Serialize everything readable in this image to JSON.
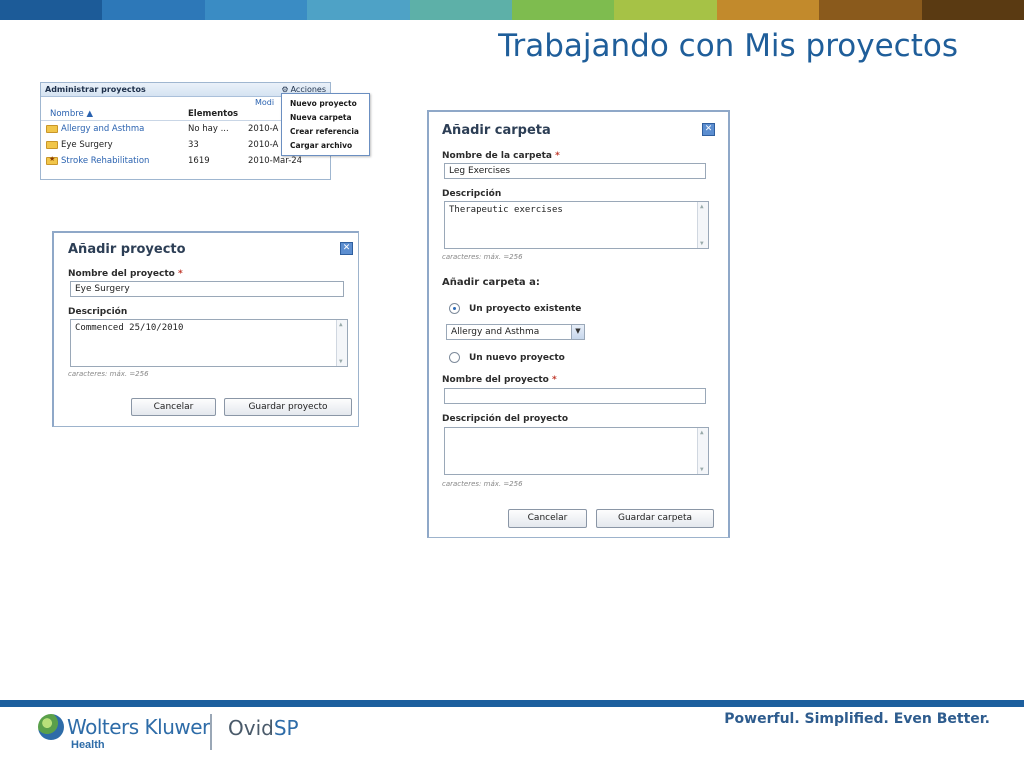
{
  "slide": {
    "title": "Trabajando con Mis proyectos",
    "banner_colors": [
      "#1c5b98",
      "#2d78b8",
      "#3a8cc4",
      "#4ea2c6",
      "#5db0a8",
      "#7ebc4f",
      "#a6c246",
      "#c28a2c",
      "#8a5a1c",
      "#5a3a12"
    ]
  },
  "manage_panel": {
    "header": "Administrar proyectos",
    "actions_label": "Acciones",
    "modify_label": "Modi",
    "columns": {
      "name": "Nombre ▲",
      "elements": "Elementos"
    },
    "rows": [
      {
        "name": "Allergy and Asthma",
        "elements": "No hay ...",
        "date": "2010-A",
        "icon": "folder-icon"
      },
      {
        "name": "Eye Surgery",
        "elements": "33",
        "date": "2010-A",
        "icon": "folder-icon"
      },
      {
        "name": "Stroke Rehabilitation",
        "elements": "1619",
        "date": "2010-Mar-24",
        "icon": "folder-star-icon"
      }
    ],
    "menu": [
      "Nuevo proyecto",
      "Nueva carpeta",
      "Crear referencia",
      "Cargar archivo"
    ]
  },
  "add_project": {
    "title": "Añadir proyecto",
    "name_label": "Nombre del proyecto",
    "required_mark": "*",
    "name_value": "Eye Surgery",
    "description_label": "Descripción",
    "description_value": "Commenced 25/10/2010",
    "hint": "caracteres: máx. =256",
    "cancel_label": "Cancelar",
    "save_label": "Guardar proyecto"
  },
  "add_folder": {
    "title": "Añadir carpeta",
    "folder_name_label": "Nombre de la carpeta",
    "required_mark": "*",
    "folder_name_value": "Leg Exercises",
    "description_label": "Descripción",
    "description_value": "Therapeutic exercises",
    "hint": "caracteres: máx. =256",
    "add_to_label": "Añadir carpeta a:",
    "existing_project_label": "Un proyecto existente",
    "existing_project_selected": "Allergy and Asthma",
    "new_project_label": "Un nuevo proyecto",
    "project_name_label": "Nombre del proyecto",
    "project_name_value": "",
    "project_description_label": "Descripción del proyecto",
    "project_description_value": "",
    "hint2": "caracteres: máx. =256",
    "cancel_label": "Cancelar",
    "save_label": "Guardar carpeta"
  },
  "footer": {
    "brand": "Wolters Kluwer",
    "brand_sub": "Health",
    "product_a": "Ovid",
    "product_b": "SP",
    "tagline": "Powerful. Simplified. Even Better.",
    "accent_color": "#1d5f9e"
  }
}
